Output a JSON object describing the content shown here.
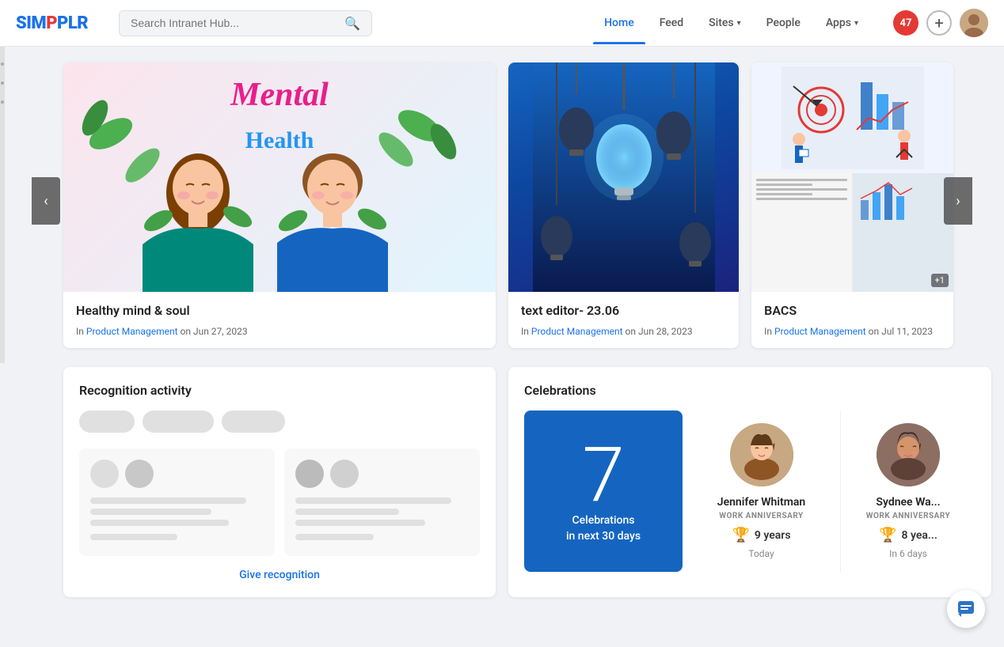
{
  "header": {
    "logo": "SIMPPLR",
    "search_placeholder": "Search Intranet Hub...",
    "nav": [
      {
        "label": "Home",
        "active": true
      },
      {
        "label": "Feed",
        "active": false
      },
      {
        "label": "Sites",
        "has_dropdown": true,
        "active": false
      },
      {
        "label": "People",
        "active": false
      },
      {
        "label": "Apps",
        "has_dropdown": true,
        "active": false
      }
    ],
    "notification_count": "47",
    "add_label": "+"
  },
  "carousel": {
    "cards": [
      {
        "id": "card1",
        "title": "Healthy mind & soul",
        "category": "Product Management",
        "date": "Jun 27, 2023",
        "type": "mental-health"
      },
      {
        "id": "card2",
        "title": "text editor- 23.06",
        "category": "Product Management",
        "date": "Jun 28, 2023",
        "type": "lightbulb"
      },
      {
        "id": "card3",
        "title": "BACS",
        "category": "Product Management",
        "date": "Jul 11, 2023",
        "type": "bacs"
      }
    ],
    "prev_label": "‹",
    "next_label": "›"
  },
  "recognition": {
    "title": "Recognition activity",
    "give_label": "Give recognition"
  },
  "celebrations": {
    "title": "Celebrations",
    "count": "7",
    "count_desc_line1": "Celebrations",
    "count_desc_line2": "in next 30 days",
    "people": [
      {
        "name": "Jennifer Whitman",
        "type": "WORK ANNIVERSARY",
        "years": "9 years",
        "when": "Today"
      },
      {
        "name": "Sydnee Wa...",
        "type": "WORK ANNIVERSARY",
        "years": "8 yea...",
        "when": "In 6 days"
      }
    ]
  },
  "chat_fab_icon": "💬"
}
